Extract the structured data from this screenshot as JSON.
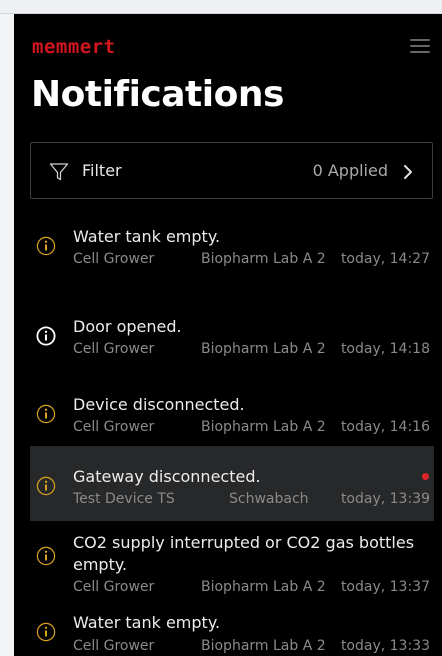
{
  "app": {
    "brand": "memmert",
    "brand_color": "#d2161e",
    "menu_icon": "hamburger-menu-icon"
  },
  "page": {
    "title": "Notifications"
  },
  "filter": {
    "label": "Filter",
    "applied": "0 Applied",
    "icon": "filter-funnel-icon",
    "chevron": "chevron-right-icon"
  },
  "notifications": [
    {
      "title": "Water tank empty.",
      "device": "Cell Grower",
      "location": "Biopharm Lab A 2",
      "time": "today, 14:27",
      "icon": "info-circle-icon",
      "icon_color": "#d9a21c",
      "selected": false,
      "unread": false
    },
    {
      "title": "Door opened.",
      "device": "Cell Grower",
      "location": "Biopharm Lab A 2",
      "time": "today, 14:18",
      "icon": "info-circle-icon",
      "icon_color": "#ffffff",
      "selected": false,
      "unread": false
    },
    {
      "title": "Device disconnected.",
      "device": "Cell Grower",
      "location": "Biopharm Lab A 2",
      "time": "today, 14:16",
      "icon": "info-circle-icon",
      "icon_color": "#d9a21c",
      "selected": false,
      "unread": false
    },
    {
      "title": "Gateway disconnected.",
      "device": "Test Device TS",
      "location": "Schwabach",
      "time": "today, 13:39",
      "icon": "info-circle-icon",
      "icon_color": "#d9a21c",
      "selected": true,
      "unread": true
    },
    {
      "title": "CO2 supply interrupted or CO2 gas bottles empty.",
      "device": "Cell Grower",
      "location": "Biopharm Lab A 2",
      "time": "today, 13:37",
      "icon": "info-circle-icon",
      "icon_color": "#d9a21c",
      "selected": false,
      "unread": false
    },
    {
      "title": "Water tank empty.",
      "device": "Cell Grower",
      "location": "Biopharm Lab A 2",
      "time": "today, 13:33",
      "icon": "info-circle-icon",
      "icon_color": "#d9a21c",
      "selected": false,
      "unread": false
    }
  ]
}
